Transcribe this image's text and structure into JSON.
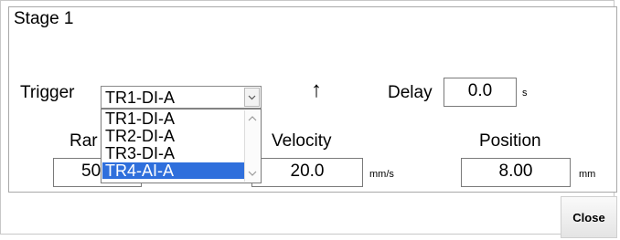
{
  "stage": {
    "title": "Stage 1"
  },
  "trigger": {
    "label": "Trigger",
    "value": "TR1-DI-A",
    "options": [
      "TR1-DI-A",
      "TR2-DI-A",
      "TR3-DI-A",
      "TR4-AI-A"
    ],
    "highlighted": "TR4-AI-A"
  },
  "direction": {
    "arrow": "↑"
  },
  "delay": {
    "label": "Delay",
    "value": "0.0",
    "unit": "s"
  },
  "ramp": {
    "label_visible": "Rar",
    "value_visible": "50"
  },
  "velocity": {
    "label": "Velocity",
    "value": "20.0",
    "unit": "mm/s"
  },
  "position": {
    "label": "Position",
    "value": "8.00",
    "unit": "mm"
  },
  "footer": {
    "close_label": "Close"
  }
}
